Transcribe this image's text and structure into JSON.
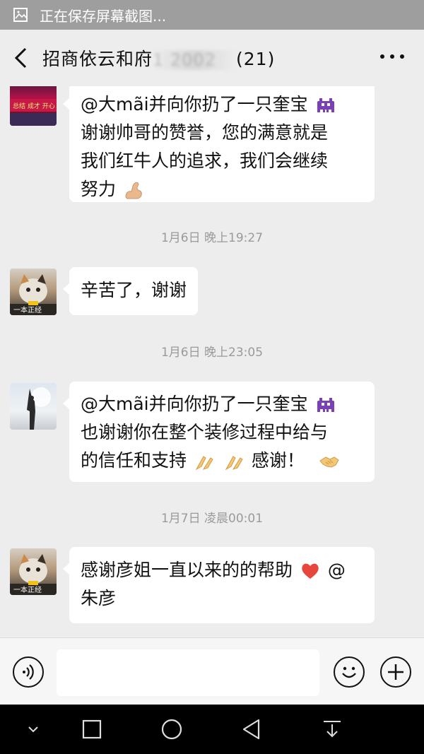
{
  "status_bar": {
    "text": "正在保存屏幕截图..."
  },
  "header": {
    "title_prefix": "招商依云和府",
    "title_hidden": "1   2002",
    "title_suffix": "(21)"
  },
  "messages": [
    {
      "type": "text",
      "sender": "红牛",
      "lines": [
        "@大mãi并向你扔了一只奎宝",
        "谢谢帅哥的赞誉，您的满意就是",
        "我们红牛人的追求，我们会继续",
        "努力"
      ],
      "avatar_caption": "总结 成才 开心"
    },
    {
      "type": "time",
      "text": "1月6日 晚上19:27"
    },
    {
      "type": "text",
      "sender": "cat",
      "lines": [
        "辛苦了，谢谢"
      ],
      "avatar_caption": "一本正经"
    },
    {
      "type": "time",
      "text": "1月6日 晚上23:05"
    },
    {
      "type": "text",
      "sender": "sky",
      "lines": [
        "@大mãi并向你扔了一只奎宝",
        "也谢谢你在整个装修过程中给与",
        "的信任和支持",
        "感谢！"
      ]
    },
    {
      "type": "time",
      "text": "1月7日 凌晨00:01"
    },
    {
      "type": "text",
      "sender": "cat",
      "lines": [
        "感谢彦姐一直以来的的帮助",
        "@",
        "朱彦"
      ],
      "avatar_caption": "一本正经"
    }
  ],
  "colors": {
    "bg": "#ededed",
    "bubble": "#ffffff",
    "status": "#9e9e9e",
    "heart": "#e8453c"
  }
}
